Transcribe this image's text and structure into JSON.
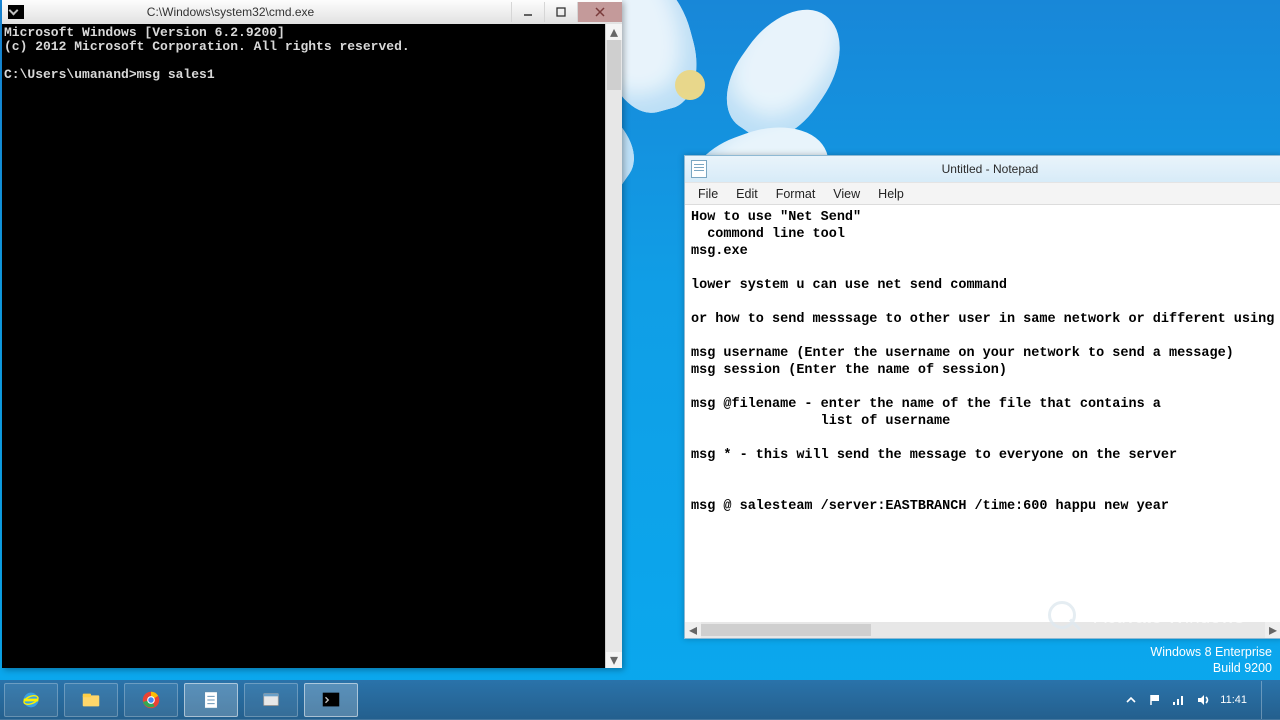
{
  "cmd": {
    "title": "C:\\Windows\\system32\\cmd.exe",
    "line1": "Microsoft Windows [Version 6.2.9200]",
    "line2": "(c) 2012 Microsoft Corporation. All rights reserved.",
    "prompt": "C:\\Users\\umanand>",
    "typed": "msg sales1"
  },
  "notepad": {
    "title": "Untitled - Notepad",
    "menu": {
      "file": "File",
      "edit": "Edit",
      "format": "Format",
      "view": "View",
      "help": "Help"
    },
    "content": "How to use \"Net Send\"\n  commond line tool\nmsg.exe\n\nlower system u can use net send command\n\nor how to send messsage to other user in same network or different using cmd\n\nmsg username (Enter the username on your network to send a message)\nmsg session (Enter the name of session)\n\nmsg @filename - enter the name of the file that contains a\n                list of username\n\nmsg * - this will send the message to everyone on the server\n\n\nmsg @ salesteam /server:EASTBRANCH /time:600 happu new year"
  },
  "watermark": {
    "line1": "Activate Windows"
  },
  "edition": {
    "line1": "Windows 8 Enterprise",
    "line2": "Build 9200"
  },
  "tray": {
    "time": "11:41",
    "date": ""
  }
}
